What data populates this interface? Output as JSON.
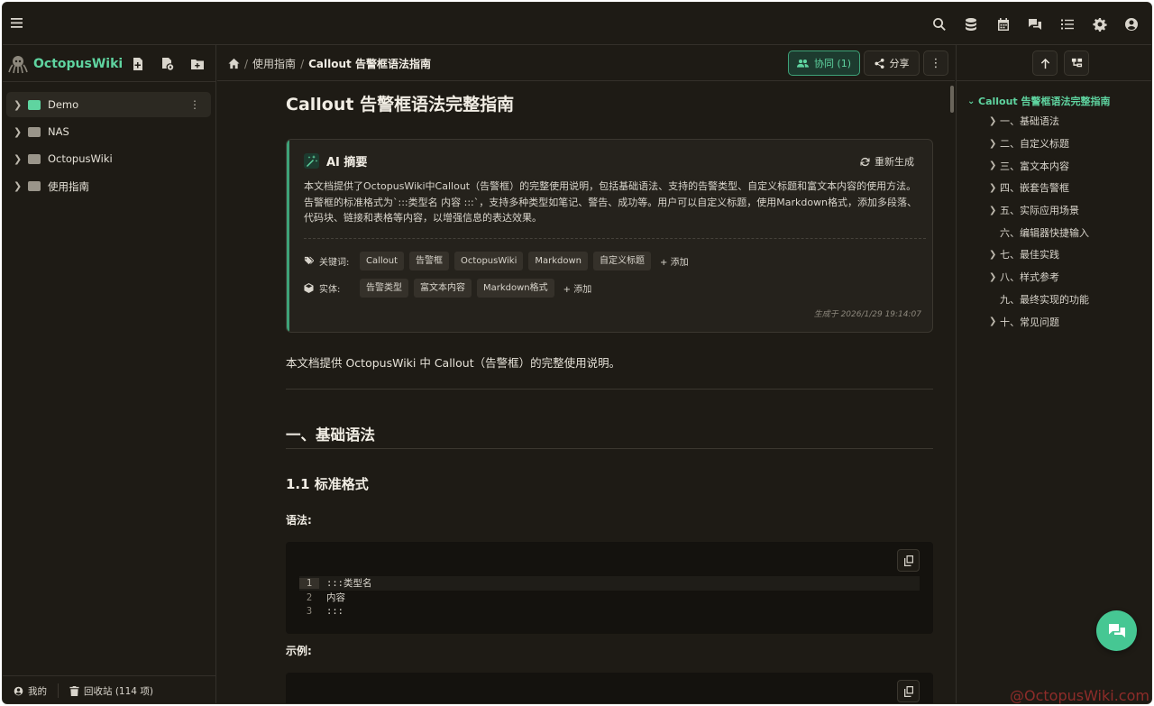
{
  "app": {
    "name": "OctopusWiki",
    "brand_color": "#5fd4a0"
  },
  "topbar": {
    "tools": [
      "search-icon",
      "database-icon",
      "calendar-icon",
      "chat-icon",
      "list-icon",
      "gear-icon",
      "user-icon"
    ]
  },
  "sidebar": {
    "actions": [
      "new-file-icon",
      "new-file-settings-icon",
      "new-folder-icon"
    ],
    "items": [
      {
        "label": "Demo",
        "folder_color": "#5fd4a0",
        "active": true
      },
      {
        "label": "NAS",
        "folder_color": "#9a958a",
        "active": false
      },
      {
        "label": "OctopusWiki",
        "folder_color": "#9a958a",
        "active": false
      },
      {
        "label": "使用指南",
        "folder_color": "#9a958a",
        "active": false
      }
    ],
    "bottom": {
      "mine": "我的",
      "trash": "回收站 (114 项)"
    }
  },
  "header": {
    "breadcrumb": [
      "使用指南",
      "Callout 告警框语法指南"
    ],
    "collab_label": "协同 (1)",
    "share_label": "分享",
    "more_label": "⋮"
  },
  "doc": {
    "title": "Callout 告警框语法完整指南",
    "ai": {
      "title": "AI 摘要",
      "regen": "重新生成",
      "summary": "本文档提供了OctopusWiki中Callout（告警框）的完整使用说明，包括基础语法、支持的告警类型、自定义标题和富文本内容的使用方法。告警框的标准格式为`:::类型名 内容 :::`，支持多种类型如笔记、警告、成功等。用户可以自定义标题，使用Markdown格式，添加多段落、代码块、链接和表格等内容，以增强信息的表达效果。",
      "keywords_label": "关键词:",
      "keywords": [
        "Callout",
        "告警框",
        "OctopusWiki",
        "Markdown",
        "自定义标题"
      ],
      "entities_label": "实体:",
      "entities": [
        "告警类型",
        "富文本内容",
        "Markdown格式"
      ],
      "add_label": "+ 添加",
      "generated": "生成于 2026/1/29 19:14:07"
    },
    "intro": "本文档提供 OctopusWiki 中 Callout（告警框）的完整使用说明。",
    "h2": "一、基础语法",
    "h3": "1.1 标准格式",
    "syntax_label": "语法:",
    "code_lines": [
      {
        "n": "1",
        "text": ":::类型名"
      },
      {
        "n": "2",
        "text": "内容"
      },
      {
        "n": "3",
        "text": ":::"
      }
    ],
    "example_label": "示例:"
  },
  "toc": {
    "root": "Callout 告警框语法完整指南",
    "items": [
      {
        "label": "一、基础语法",
        "has_children": true
      },
      {
        "label": "二、自定义标题",
        "has_children": true
      },
      {
        "label": "三、富文本内容",
        "has_children": true
      },
      {
        "label": "四、嵌套告警框",
        "has_children": true
      },
      {
        "label": "五、实际应用场景",
        "has_children": true
      },
      {
        "label": "六、编辑器快捷输入",
        "has_children": false
      },
      {
        "label": "七、最佳实践",
        "has_children": true
      },
      {
        "label": "八、样式参考",
        "has_children": true
      },
      {
        "label": "九、最终实现的功能",
        "has_children": false
      },
      {
        "label": "十、常见问题",
        "has_children": true
      }
    ]
  },
  "watermark": "@OctopusWiki.com"
}
